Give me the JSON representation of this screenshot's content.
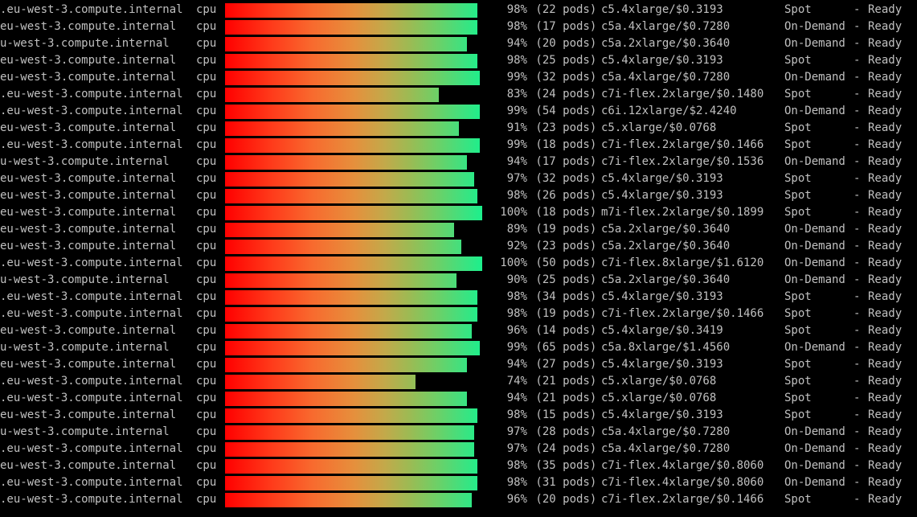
{
  "columns": {
    "metric_label": "cpu",
    "dash": "-",
    "status": "Ready"
  },
  "nodes": [
    {
      "host": ".eu-west-3.compute.internal",
      "pct": 98,
      "pods": 22,
      "itype": "c5.4xlarge/$0.3193",
      "lifecycle": "Spot"
    },
    {
      "host": "eu-west-3.compute.internal",
      "pct": 98,
      "pods": 17,
      "itype": "c5a.4xlarge/$0.7280",
      "lifecycle": "On-Demand"
    },
    {
      "host": "u-west-3.compute.internal",
      "pct": 94,
      "pods": 20,
      "itype": "c5a.2xlarge/$0.3640",
      "lifecycle": "On-Demand"
    },
    {
      "host": "eu-west-3.compute.internal",
      "pct": 98,
      "pods": 25,
      "itype": "c5.4xlarge/$0.3193",
      "lifecycle": "Spot"
    },
    {
      "host": "eu-west-3.compute.internal",
      "pct": 99,
      "pods": 32,
      "itype": "c5a.4xlarge/$0.7280",
      "lifecycle": "On-Demand"
    },
    {
      "host": ".eu-west-3.compute.internal",
      "pct": 83,
      "pods": 24,
      "itype": "c7i-flex.2xlarge/$0.1480",
      "lifecycle": "Spot"
    },
    {
      "host": ".eu-west-3.compute.internal",
      "pct": 99,
      "pods": 54,
      "itype": "c6i.12xlarge/$2.4240",
      "lifecycle": "On-Demand"
    },
    {
      "host": "eu-west-3.compute.internal",
      "pct": 91,
      "pods": 23,
      "itype": "c5.xlarge/$0.0768",
      "lifecycle": "Spot"
    },
    {
      "host": ".eu-west-3.compute.internal",
      "pct": 99,
      "pods": 18,
      "itype": "c7i-flex.2xlarge/$0.1466",
      "lifecycle": "Spot"
    },
    {
      "host": "u-west-3.compute.internal",
      "pct": 94,
      "pods": 17,
      "itype": "c7i-flex.2xlarge/$0.1536",
      "lifecycle": "On-Demand"
    },
    {
      "host": "eu-west-3.compute.internal",
      "pct": 97,
      "pods": 32,
      "itype": "c5.4xlarge/$0.3193",
      "lifecycle": "Spot"
    },
    {
      "host": "eu-west-3.compute.internal",
      "pct": 98,
      "pods": 26,
      "itype": "c5.4xlarge/$0.3193",
      "lifecycle": "Spot"
    },
    {
      "host": "eu-west-3.compute.internal",
      "pct": 100,
      "pods": 18,
      "itype": "m7i-flex.2xlarge/$0.1899",
      "lifecycle": "Spot"
    },
    {
      "host": "eu-west-3.compute.internal",
      "pct": 89,
      "pods": 19,
      "itype": "c5a.2xlarge/$0.3640",
      "lifecycle": "On-Demand"
    },
    {
      "host": "eu-west-3.compute.internal",
      "pct": 92,
      "pods": 23,
      "itype": "c5a.2xlarge/$0.3640",
      "lifecycle": "On-Demand"
    },
    {
      "host": ".eu-west-3.compute.internal",
      "pct": 100,
      "pods": 50,
      "itype": "c7i-flex.8xlarge/$1.6120",
      "lifecycle": "On-Demand"
    },
    {
      "host": "u-west-3.compute.internal",
      "pct": 90,
      "pods": 25,
      "itype": "c5a.2xlarge/$0.3640",
      "lifecycle": "On-Demand"
    },
    {
      "host": ".eu-west-3.compute.internal",
      "pct": 98,
      "pods": 34,
      "itype": "c5.4xlarge/$0.3193",
      "lifecycle": "Spot"
    },
    {
      "host": ".eu-west-3.compute.internal",
      "pct": 98,
      "pods": 19,
      "itype": "c7i-flex.2xlarge/$0.1466",
      "lifecycle": "Spot"
    },
    {
      "host": "eu-west-3.compute.internal",
      "pct": 96,
      "pods": 14,
      "itype": "c5.4xlarge/$0.3419",
      "lifecycle": "Spot"
    },
    {
      "host": "u-west-3.compute.internal",
      "pct": 99,
      "pods": 65,
      "itype": "c5a.8xlarge/$1.4560",
      "lifecycle": "On-Demand"
    },
    {
      "host": "eu-west-3.compute.internal",
      "pct": 94,
      "pods": 27,
      "itype": "c5.4xlarge/$0.3193",
      "lifecycle": "Spot"
    },
    {
      "host": ".eu-west-3.compute.internal",
      "pct": 74,
      "pods": 21,
      "itype": "c5.xlarge/$0.0768",
      "lifecycle": "Spot"
    },
    {
      "host": ".eu-west-3.compute.internal",
      "pct": 94,
      "pods": 21,
      "itype": "c5.xlarge/$0.0768",
      "lifecycle": "Spot"
    },
    {
      "host": "eu-west-3.compute.internal",
      "pct": 98,
      "pods": 15,
      "itype": "c5.4xlarge/$0.3193",
      "lifecycle": "Spot"
    },
    {
      "host": "u-west-3.compute.internal",
      "pct": 97,
      "pods": 28,
      "itype": "c5a.4xlarge/$0.7280",
      "lifecycle": "On-Demand"
    },
    {
      "host": ".eu-west-3.compute.internal",
      "pct": 97,
      "pods": 24,
      "itype": "c5a.4xlarge/$0.7280",
      "lifecycle": "On-Demand"
    },
    {
      "host": "eu-west-3.compute.internal",
      "pct": 98,
      "pods": 35,
      "itype": "c7i-flex.4xlarge/$0.8060",
      "lifecycle": "On-Demand"
    },
    {
      "host": ".eu-west-3.compute.internal",
      "pct": 98,
      "pods": 31,
      "itype": "c7i-flex.4xlarge/$0.8060",
      "lifecycle": "On-Demand"
    },
    {
      "host": ".eu-west-3.compute.internal",
      "pct": 96,
      "pods": 20,
      "itype": "c7i-flex.2xlarge/$0.1466",
      "lifecycle": "Spot"
    }
  ]
}
